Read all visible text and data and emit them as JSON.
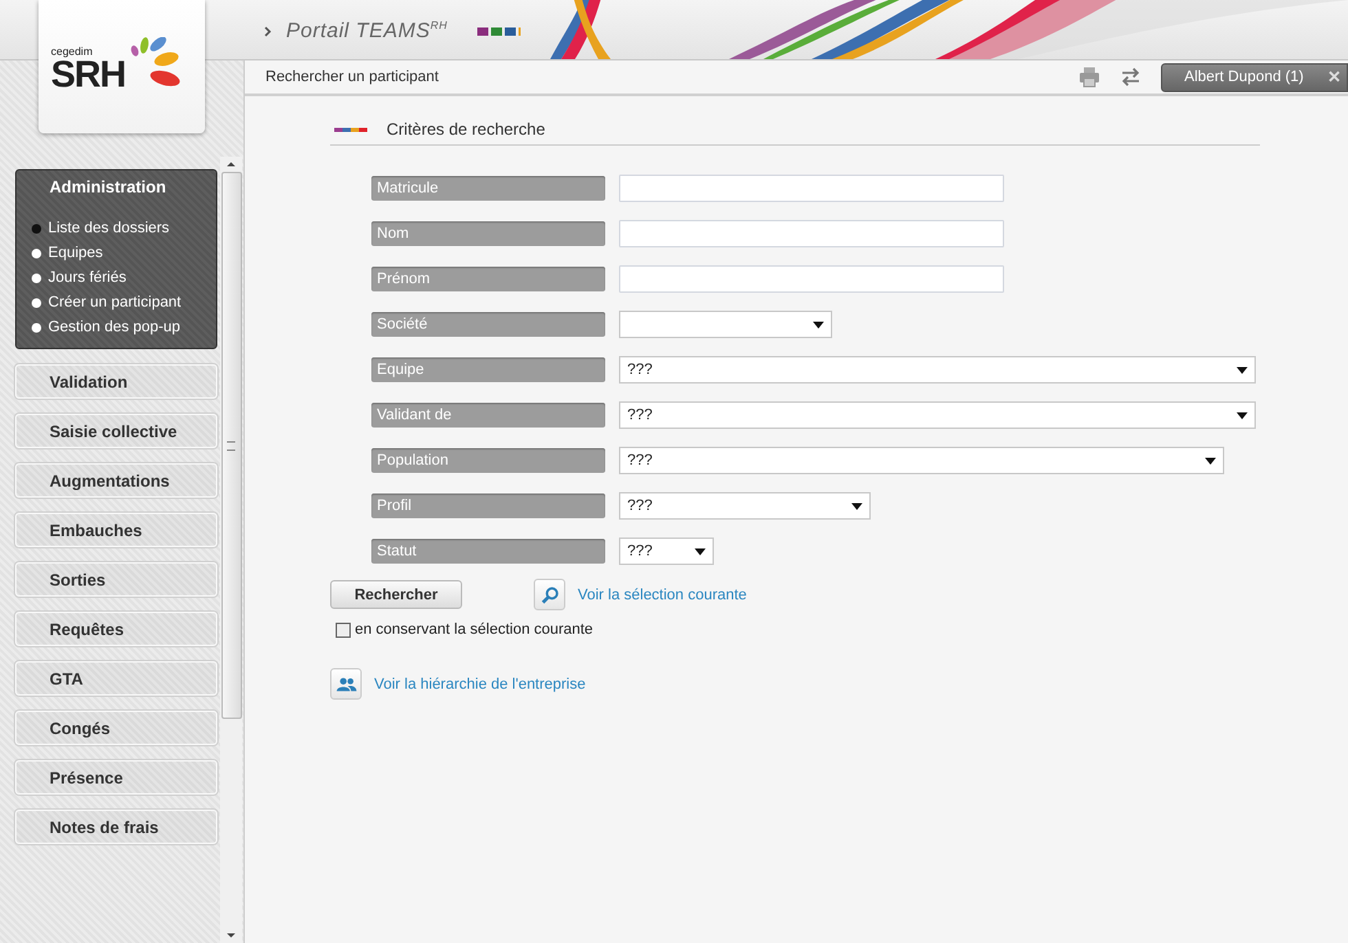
{
  "logo": {
    "small": "cegedim",
    "big": "SRH"
  },
  "header": {
    "title": "Portail TEAMS$^{RH}$"
  },
  "breadcrumb": "Rechercher un participant",
  "user_tab": {
    "label": "Albert Dupond (1)",
    "close": "✕"
  },
  "sidebar": {
    "items": [
      {
        "label": "Administration",
        "expanded": true,
        "children": [
          {
            "label": "Liste des dossiers",
            "selected": true
          },
          {
            "label": "Equipes",
            "selected": false
          },
          {
            "label": "Jours fériés",
            "selected": false
          },
          {
            "label": "Créer un participant",
            "selected": false
          },
          {
            "label": "Gestion des pop-up",
            "selected": false
          }
        ]
      },
      {
        "label": "Validation",
        "expanded": false
      },
      {
        "label": "Saisie collective",
        "expanded": false
      },
      {
        "label": "Augmentations",
        "expanded": false
      },
      {
        "label": "Embauches",
        "expanded": false
      },
      {
        "label": "Sorties",
        "expanded": false
      },
      {
        "label": "Requêtes",
        "expanded": false
      },
      {
        "label": "GTA",
        "expanded": false
      },
      {
        "label": "Congés",
        "expanded": false
      },
      {
        "label": "Présence",
        "expanded": false
      },
      {
        "label": "Notes de frais",
        "expanded": false
      }
    ]
  },
  "section_title": "Critères de recherche",
  "fields": [
    {
      "label": "Matricule",
      "kind": "text"
    },
    {
      "label": "Nom",
      "kind": "text"
    },
    {
      "label": "Prénom",
      "kind": "text"
    },
    {
      "label": "Société",
      "kind": "select"
    },
    {
      "label": "Equipe",
      "kind": "select",
      "value": "???"
    },
    {
      "label": "Validant de",
      "kind": "select",
      "value": "???"
    },
    {
      "label": "Population",
      "kind": "select",
      "value": "???"
    },
    {
      "label": "Profil",
      "kind": "select",
      "value": "???"
    },
    {
      "label": "Statut",
      "kind": "select",
      "value": "???"
    }
  ],
  "search_button": "Rechercher",
  "current_selection_link": "Voir la sélection courante",
  "keep_selection": {
    "label": "en conservant la sélection courante",
    "checked": false
  },
  "hierarchy_link": "Voir la hiérarchie de l'entreprise"
}
